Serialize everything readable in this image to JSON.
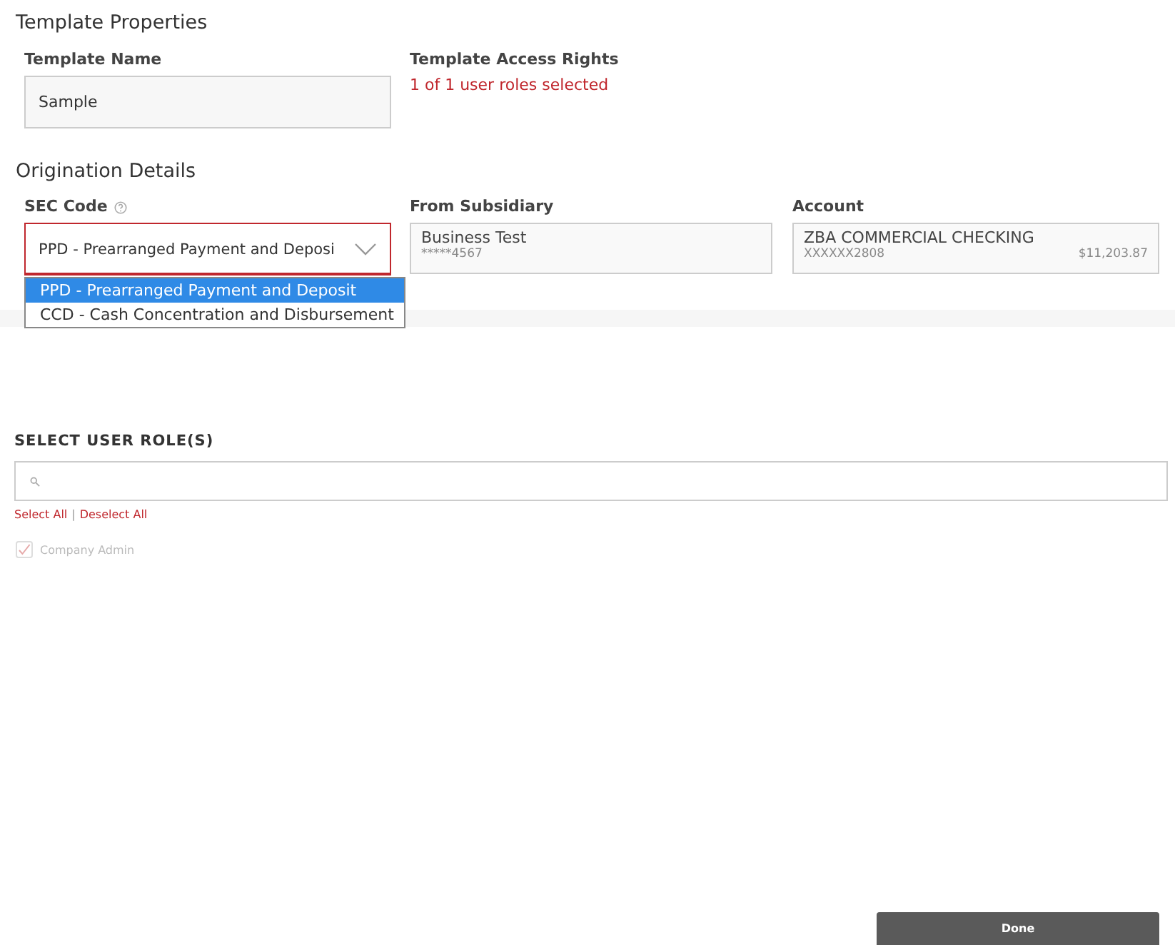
{
  "template_properties": {
    "title": "Template Properties",
    "template_name": {
      "label": "Template Name",
      "value": "Sample"
    },
    "access_rights": {
      "label": "Template Access Rights",
      "summary": "1 of 1 user roles selected"
    }
  },
  "origination_details": {
    "title": "Origination Details",
    "sec_code": {
      "label": "SEC Code",
      "value": "PPD - Prearranged Payment and Deposi",
      "expanded": true,
      "options": [
        {
          "label": "PPD - Prearranged Payment and Deposit",
          "selected": true
        },
        {
          "label": "CCD - Cash Concentration and Disbursement",
          "selected": false
        }
      ]
    },
    "from_subsidiary": {
      "label": "From Subsidiary",
      "name": "Business Test",
      "number": "*****4567"
    },
    "account": {
      "label": "Account",
      "name": "ZBA COMMERCIAL CHECKING",
      "number": "XXXXXX2808",
      "balance": "$11,203.87"
    }
  },
  "user_roles": {
    "title": "SELECT USER ROLE(S)",
    "select_all": "Select All",
    "separator": "|",
    "deselect_all": "Deselect All",
    "roles": [
      {
        "label": "Company Admin",
        "checked": true,
        "disabled": true
      }
    ]
  },
  "done_button": "Done"
}
